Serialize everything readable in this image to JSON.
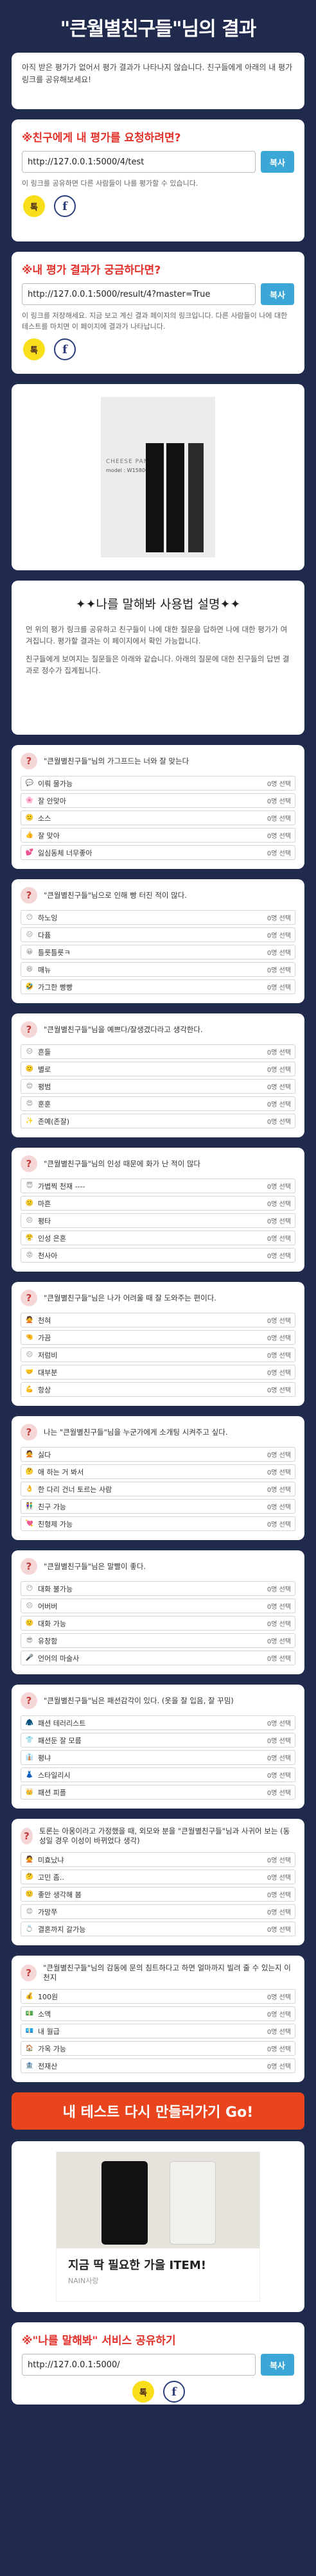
{
  "header": {
    "title": "\"큰월별친구들\"님의 결과"
  },
  "intro": {
    "text": "아직 받은 평가가 없어서 평가 결과가 나타나지 않습니다. 친구들에게 아래의 내 평가 링크를 공유해보세요!"
  },
  "request_share": {
    "title": "※친구에게 내 평가를 요청하려면?",
    "url": "http://127.0.0.1:5000/4/test",
    "copy_label": "복사",
    "note": "이 링크를 공유하면 다른 사람들이 나를 평가할 수 있습니다.",
    "kakao_label": "톡",
    "facebook_label": "f"
  },
  "result_share": {
    "title": "※내 평가 결과가 궁금하다면?",
    "url": "http://127.0.0.1:5000/result/4?master=True",
    "copy_label": "복사",
    "note": "이 링크를 저장해세요. 지금 보고 계신 결과 페이지의 링크입니다. 다른 사람들이 나에 대한 테스트를 마치면 이 페이지에 결과가 나타납니다.",
    "kakao_label": "톡",
    "facebook_label": "f"
  },
  "ad1": {
    "brand": "CHEESE PANTS",
    "model": "model : W15800"
  },
  "guide": {
    "title": "✦✦나를 말해봐 사용법 설명✦✦",
    "p1": "먼 위의 평가 링크를 공유하고 친구들이 나에 대한 질문을 답하면 나에 대한 평가가 여겨집니다. 평가할 결과는 이 페이지에서 확인 가능합니다.",
    "p2": "친구들에게 보여지는 질문들은 아래와 같습니다. 아래의 질문에 대한 친구들의 답변 결과로 정수가 집계됩니다."
  },
  "questions": [
    {
      "text": "\"큰월별친구들\"님의 가그프드는 너와 잘 맞는다",
      "options": [
        {
          "icon": "💬",
          "label": "이뤄 물가능",
          "count": "0명 선택"
        },
        {
          "icon": "🌸",
          "label": "잘 안맞아",
          "count": "0명 선택"
        },
        {
          "icon": "🙂",
          "label": "소스",
          "count": "0명 선택"
        },
        {
          "icon": "👍",
          "label": "잘 맞아",
          "count": "0명 선택"
        },
        {
          "icon": "💕",
          "label": "잃심동체 너무좋아",
          "count": "0명 선택"
        }
      ]
    },
    {
      "text": "\"큰월별친구들\"님으로 인해 빵 터진 적이 많다.",
      "options": [
        {
          "icon": "😶",
          "label": "하노잉",
          "count": "0명 선택"
        },
        {
          "icon": "😐",
          "label": "다퓸",
          "count": "0명 선택"
        },
        {
          "icon": "😀",
          "label": "틀릇틀릇ㅋ",
          "count": "0명 선택"
        },
        {
          "icon": "😆",
          "label": "매뉴",
          "count": "0명 선택"
        },
        {
          "icon": "🤣",
          "label": "가그한 빵빵",
          "count": "0명 선택"
        }
      ]
    },
    {
      "text": "\"큰월별친구들\"님을 예쁘다/잘생겼다라고 생각한다.",
      "options": [
        {
          "icon": "😑",
          "label": "흔들",
          "count": "0명 선택"
        },
        {
          "icon": "🙂",
          "label": "별로",
          "count": "0명 선택"
        },
        {
          "icon": "😊",
          "label": "평범",
          "count": "0명 선택"
        },
        {
          "icon": "😍",
          "label": "훈훈",
          "count": "0명 선택"
        },
        {
          "icon": "✨",
          "label": "존예(존잘)",
          "count": "0명 선택"
        }
      ]
    },
    {
      "text": "\"큰월별친구들\"님의 인성 때문에 화가 난 적이 많다",
      "options": [
        {
          "icon": "😇",
          "label": "가볍찍 천재 ----",
          "count": "0명 선택"
        },
        {
          "icon": "🙂",
          "label": "마흔",
          "count": "0명 선택"
        },
        {
          "icon": "😐",
          "label": "평타",
          "count": "0명 선택"
        },
        {
          "icon": "😤",
          "label": "인성 은혼",
          "count": "0명 선택"
        },
        {
          "icon": "😡",
          "label": "천사아",
          "count": "0명 선택"
        }
      ]
    },
    {
      "text": "\"큰월별친구들\"님은 나가 어려울 때 잘 도와주는 편이다.",
      "options": [
        {
          "icon": "🙅",
          "label": "천혀",
          "count": "0명 선택"
        },
        {
          "icon": "🤏",
          "label": "가끔",
          "count": "0명 선택"
        },
        {
          "icon": "😐",
          "label": "저럼비",
          "count": "0명 선택"
        },
        {
          "icon": "🤝",
          "label": "대부분",
          "count": "0명 선택"
        },
        {
          "icon": "💪",
          "label": "항상",
          "count": "0명 선택"
        }
      ]
    },
    {
      "text": "나는 \"큰월별친구들\"님을 누군가에게 소개팅 시켜주고 싶다.",
      "options": [
        {
          "icon": "🙅",
          "label": "싫다",
          "count": "0명 선택"
        },
        {
          "icon": "🤔",
          "label": "애 하는 거 봐서",
          "count": "0명 선택"
        },
        {
          "icon": "👌",
          "label": "한 다리 건너 토르는 사람",
          "count": "0명 선택"
        },
        {
          "icon": "👫",
          "label": "친구 가능",
          "count": "0명 선택"
        },
        {
          "icon": "💘",
          "label": "친형제 가능",
          "count": "0명 선택"
        }
      ]
    },
    {
      "text": "\"큰월별친구들\"님은 말빨이 좋다.",
      "options": [
        {
          "icon": "😶",
          "label": "대화 불가능",
          "count": "0명 선택"
        },
        {
          "icon": "😐",
          "label": "어버버",
          "count": "0명 선택"
        },
        {
          "icon": "🙂",
          "label": "대화 가능",
          "count": "0명 선택"
        },
        {
          "icon": "😎",
          "label": "유창함",
          "count": "0명 선택"
        },
        {
          "icon": "🎤",
          "label": "언어의 마술사",
          "count": "0명 선택"
        }
      ]
    },
    {
      "text": "\"큰월별친구들\"님은 패션감각이 있다. (옷을 잘 입음, 잘 꾸밈)",
      "options": [
        {
          "icon": "🧥",
          "label": "패션 테러리스트",
          "count": "0명 선택"
        },
        {
          "icon": "👕",
          "label": "패션둔 잘 모름",
          "count": "0명 선택"
        },
        {
          "icon": "👔",
          "label": "평냐",
          "count": "0명 선택"
        },
        {
          "icon": "👗",
          "label": "스타일리시",
          "count": "0명 선택"
        },
        {
          "icon": "👑",
          "label": "패션 피플",
          "count": "0명 선택"
        }
      ]
    },
    {
      "text": "토론는 아웅이라고 가정했을 때, 외모와 분을 \"큰월별친구들\"님과 사귀어 보는 (동성일 경우 이성이 바뀌었다 생각)",
      "options": [
        {
          "icon": "🙅",
          "label": "미효났냐",
          "count": "0명 선택"
        },
        {
          "icon": "🤔",
          "label": "고민 좀..",
          "count": "0명 선택"
        },
        {
          "icon": "🙂",
          "label": "좋안 생각해 봄",
          "count": "0명 선택"
        },
        {
          "icon": "😊",
          "label": "가망쭈",
          "count": "0명 선택"
        },
        {
          "icon": "💍",
          "label": "결혼까지 갈가능",
          "count": "0명 선택"
        }
      ]
    },
    {
      "text": "\"큰월별친구들\"님의 감동에 문의 침트하다고 하면 얼마까지 빌려 줄 수 있는지 이천지",
      "options": [
        {
          "icon": "💰",
          "label": "100원",
          "count": "0명 선택"
        },
        {
          "icon": "💵",
          "label": "소액",
          "count": "0명 선택"
        },
        {
          "icon": "💶",
          "label": "내 월급",
          "count": "0명 선택"
        },
        {
          "icon": "🏠",
          "label": "가옥 가능",
          "count": "0명 선택"
        },
        {
          "icon": "🏦",
          "label": "전재산",
          "count": "0명 선택"
        }
      ]
    }
  ],
  "retry": {
    "label": "내 테스트 다시 만들러가기 Go!"
  },
  "ad2": {
    "title": "지금 딱 필요한 가을 ITEM!",
    "sub": "NAIN사랑"
  },
  "service_share": {
    "title": "※\"나를 말해봐\" 서비스 공유하기",
    "url": "http://127.0.0.1:5000/",
    "copy_label": "복사",
    "kakao_label": "톡",
    "facebook_label": "f"
  }
}
